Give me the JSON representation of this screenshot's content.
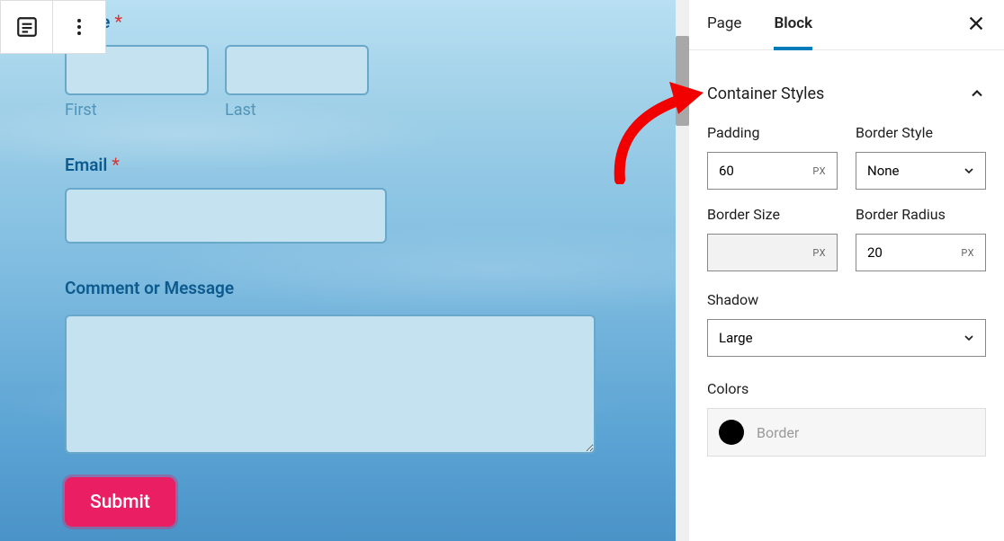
{
  "form": {
    "name_label": "Name",
    "first_sublabel": "First",
    "last_sublabel": "Last",
    "email_label": "Email",
    "comment_label": "Comment or Message",
    "submit_label": "Submit"
  },
  "sidebar": {
    "tabs": {
      "page": "Page",
      "block": "Block"
    },
    "panel_title": "Container Styles",
    "fields": {
      "padding_label": "Padding",
      "padding_value": "60",
      "padding_unit": "PX",
      "border_style_label": "Border Style",
      "border_style_value": "None",
      "border_size_label": "Border Size",
      "border_size_value": "",
      "border_size_unit": "PX",
      "border_radius_label": "Border Radius",
      "border_radius_value": "20",
      "border_radius_unit": "PX",
      "shadow_label": "Shadow",
      "shadow_value": "Large",
      "colors_label": "Colors",
      "color_border_label": "Border"
    }
  }
}
